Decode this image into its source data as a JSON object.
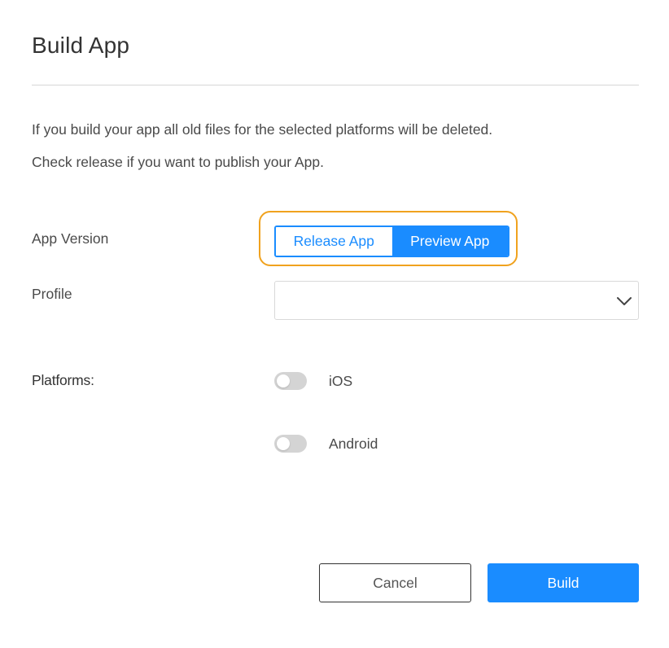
{
  "dialog": {
    "title": "Build App",
    "description": [
      "If you build your app all old files for the selected platforms will be deleted.",
      "Check release if you want to publish your App."
    ]
  },
  "app_version": {
    "label": "App Version",
    "options": [
      "Release App",
      "Preview App"
    ],
    "selected": "Preview App"
  },
  "profile": {
    "label": "Profile",
    "value": ""
  },
  "platforms": {
    "label": "Platforms:",
    "items": [
      {
        "label": "iOS",
        "enabled": false
      },
      {
        "label": "Android",
        "enabled": false
      }
    ]
  },
  "actions": {
    "cancel_label": "Cancel",
    "build_label": "Build"
  },
  "colors": {
    "accent": "#1a8cff",
    "highlight": "#f0a21e",
    "toggle_off": "#d4d4d4",
    "divider": "#d6d6d6"
  },
  "icons": {
    "select_chevron": "chevron-down-icon"
  }
}
